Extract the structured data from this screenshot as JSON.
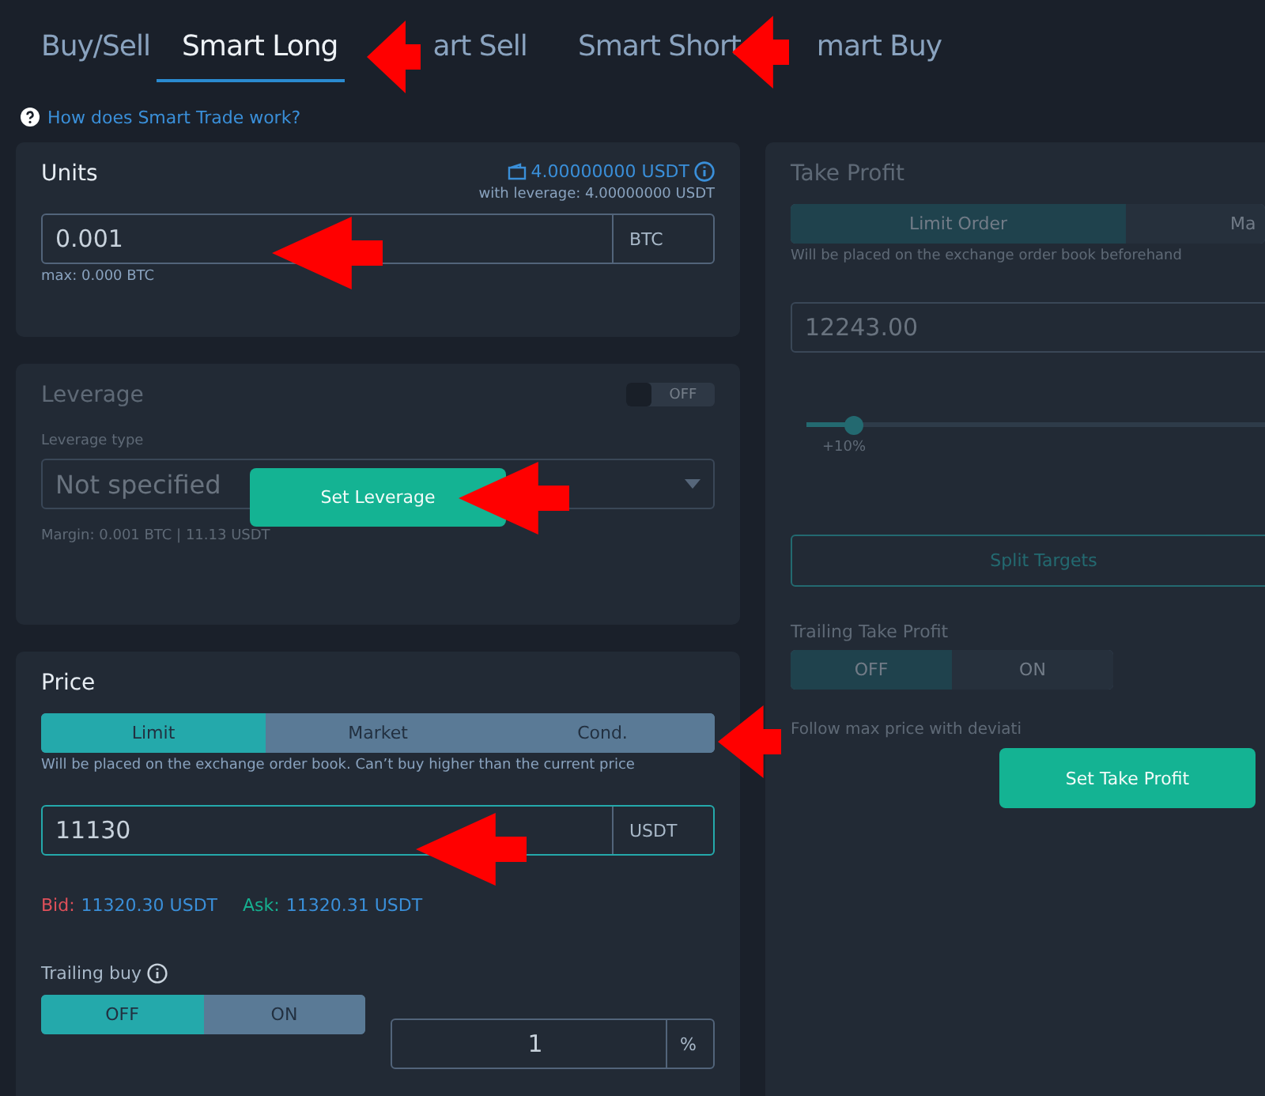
{
  "tabs": [
    {
      "label": "Buy/Sell",
      "selected": false
    },
    {
      "label": "Smart Long",
      "selected": true
    },
    {
      "label": "art Sell",
      "selected": false
    },
    {
      "label": "Smart Short",
      "selected": false
    },
    {
      "label": "mart Buy",
      "selected": false
    }
  ],
  "help_link": "How does Smart Trade work?",
  "units": {
    "title": "Units",
    "balance": "4.00000000 USDT",
    "leverage_note": "with leverage: 4.00000000 USDT",
    "value": "0.001",
    "unit": "BTC",
    "max": "max: 0.000 BTC"
  },
  "leverage": {
    "disabled": true,
    "title": "Leverage",
    "toggle": {
      "label": "OFF",
      "on": false
    },
    "type_label": "Leverage type",
    "type_value": "Not specified",
    "margin": "Margin: 0.001 BTC | 11.13 USDT",
    "button": "Set Leverage"
  },
  "price": {
    "title": "Price",
    "order_types": [
      {
        "label": "Limit",
        "selected": true
      },
      {
        "label": "Market",
        "selected": false
      },
      {
        "label": "Cond.",
        "selected": false
      }
    ],
    "hint": "Will be placed on the exchange order book. Can’t buy higher than the current price",
    "value": "11130",
    "unit": "USDT",
    "bid_label": "Bid:",
    "bid": "11320.30 USDT",
    "ask_label": "Ask:",
    "ask": "11320.31 USDT",
    "trailing": {
      "label": "Trailing buy",
      "options": [
        {
          "label": "OFF",
          "selected": true
        },
        {
          "label": "ON",
          "selected": false
        }
      ],
      "value": "1",
      "unit": "%"
    }
  },
  "take_profit": {
    "disabled": true,
    "title": "Take Profit",
    "order_types": [
      {
        "label": "Limit Order",
        "selected": true
      },
      {
        "label": "Ma",
        "selected": false
      }
    ],
    "hint": "Will be placed on the exchange order book beforehand",
    "value": "12243.00",
    "slider": {
      "level": 0.1,
      "reading": "+10%"
    },
    "split": "Split Targets",
    "trailing": {
      "label": "Trailing Take Profit",
      "options": [
        {
          "label": "OFF",
          "selected": true
        },
        {
          "label": "ON",
          "selected": false
        }
      ],
      "hint": "Follow max price with deviati"
    },
    "button": "Set Take Profit"
  }
}
